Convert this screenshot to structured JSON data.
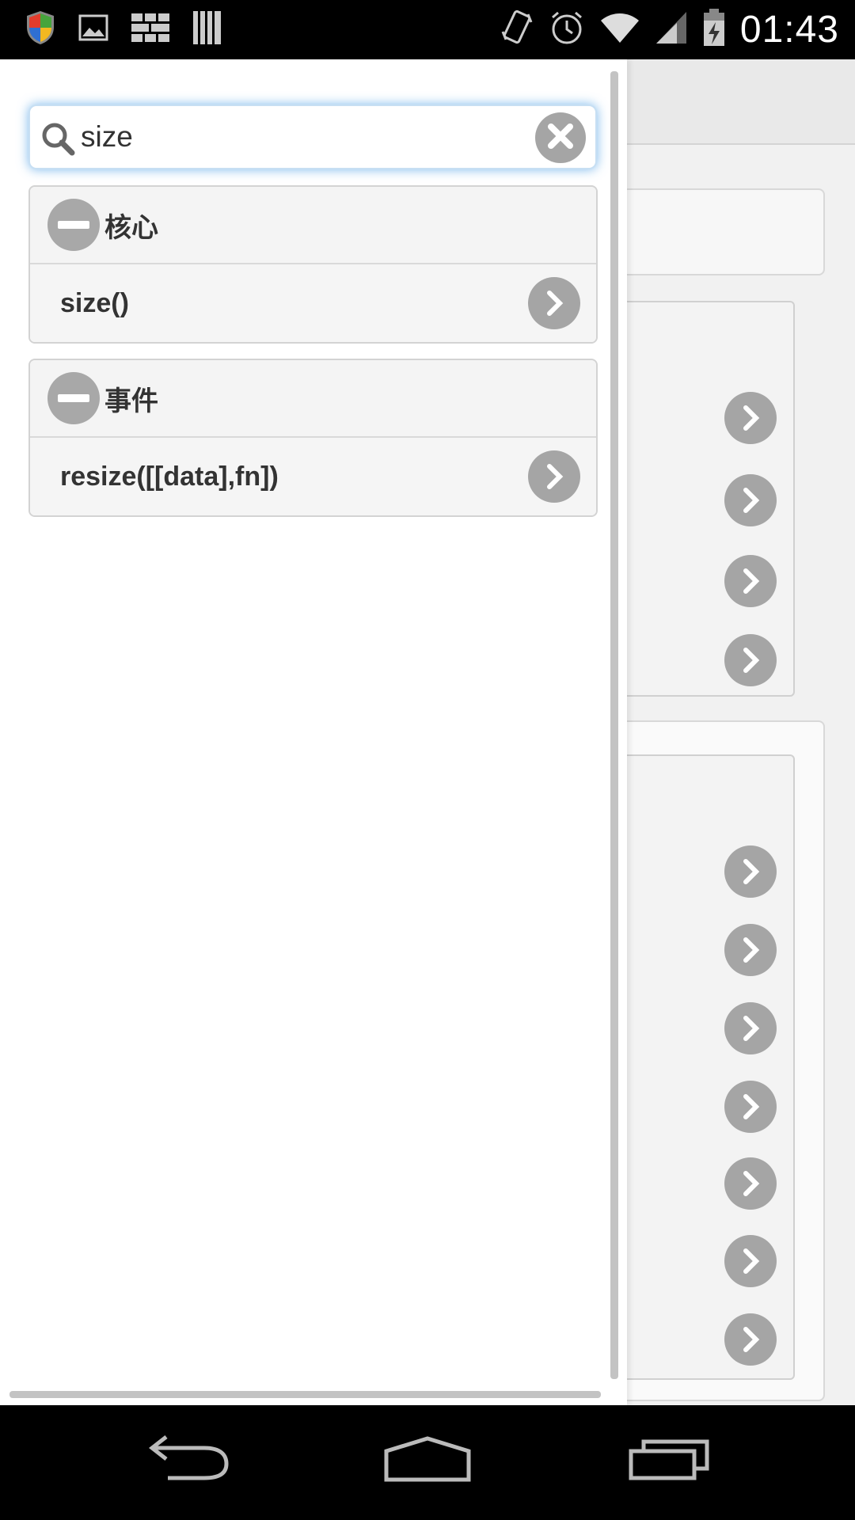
{
  "status_bar": {
    "time": "01:43",
    "left_icons": [
      "shield-icon",
      "image-icon",
      "keyboard-icon",
      "barcode-icon"
    ],
    "right_icons": [
      "vibrate-icon",
      "alarm-icon",
      "wifi-icon",
      "signal-icon",
      "battery-charging-icon"
    ]
  },
  "search": {
    "value": "size",
    "placeholder": ""
  },
  "groups": [
    {
      "title": "核心",
      "items": [
        "size()"
      ]
    },
    {
      "title": "事件",
      "items": [
        "resize([[data],fn])"
      ]
    }
  ],
  "nav_bar": {
    "buttons": [
      "back-icon",
      "home-icon",
      "recent-apps-icon"
    ]
  },
  "colors": {
    "accent_glow": "#50a0e6",
    "button_gray": "#a5a5a5"
  }
}
